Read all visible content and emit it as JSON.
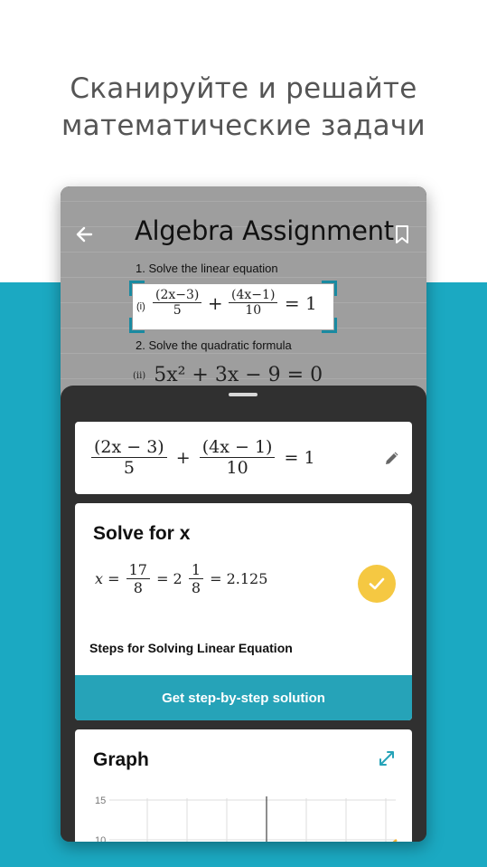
{
  "headline": {
    "line1": "Сканируйте и решайте",
    "line2": "математические задачи"
  },
  "paper": {
    "title": "Algebra Assignment",
    "q1": "1. Solve the linear equation",
    "q1_label": "(i)",
    "q1_expr": {
      "n1": "(2x−3)",
      "d1": "5",
      "op": "+",
      "n2": "(4x−1)",
      "d2": "10",
      "rhs": "= 1"
    },
    "q2": "2. Solve the quadratic formula",
    "q2_label": "(ii)",
    "q2_expr": "5x² + 3x − 9 = 0"
  },
  "equation_card": {
    "n1": "(2x − 3)",
    "d1": "5",
    "op": "+",
    "n2": "(4x − 1)",
    "d2": "10",
    "rhs": "= 1"
  },
  "solve_card": {
    "title": "Solve for x",
    "lhs": "x =",
    "f1_num": "17",
    "f1_den": "8",
    "eq2": "= 2",
    "f2_num": "1",
    "f2_den": "8",
    "result": "= 2.125",
    "steps_label": "Steps for Solving Linear Equation",
    "button_label": "Get step-by-step solution"
  },
  "graph_card": {
    "title": "Graph",
    "y_tick_top": "15",
    "y_tick_next": "10"
  },
  "colors": {
    "teal": "#1ba9c2",
    "button": "#26a3b8",
    "check": "#f5c842",
    "headline": "#555555"
  },
  "icons": [
    "arrow-left-icon",
    "bookmark-icon",
    "pencil-icon",
    "check-icon",
    "expand-icon"
  ]
}
